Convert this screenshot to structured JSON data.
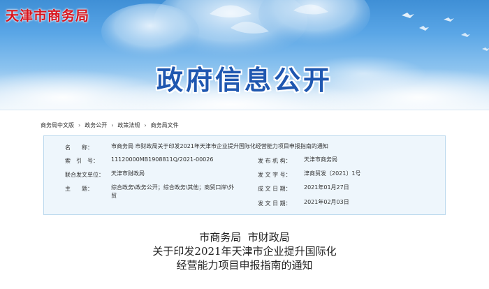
{
  "header": {
    "site_name": "天津市商务局",
    "banner_title": "政府信息公开"
  },
  "breadcrumb": {
    "items": [
      "商务局中文版",
      "政务公开",
      "政策法规",
      "商务局文件"
    ],
    "separator": "›"
  },
  "info": {
    "name_label": "名　　称：",
    "name_value": "市商务局 市财政局关于印发2021年天津市企业提升国际化经营能力项目申报指南的通知",
    "index_label": "索　引　号：",
    "index_value": "11120000MB1908811Q/2021-00026",
    "issuer_label": "发 布 机 构：",
    "issuer_value": "天津市商务局",
    "co_issuer_label": "联合发文单位：",
    "co_issuer_value": "天津市财政局",
    "doc_number_label": "发 文 字 号：",
    "doc_number_value": "津商贸发〔2021〕1号",
    "subject_label": "主　　题：",
    "subject_value": "综合政务\\政务公开；综合政务\\其他；商贸口岸\\外贸",
    "created_label": "成 文 日 期：",
    "created_value": "2021年01月27日",
    "published_label": "发 文 日 期：",
    "published_value": "2021年02月03日"
  },
  "article": {
    "title_line1": "市商务局  市财政局",
    "title_line2": "关于印发2021年天津市企业提升国际化",
    "title_line3": "经营能力项目申报指南的通知"
  },
  "colors": {
    "site_name": "#d9141c",
    "banner_title": "#1f57b0",
    "info_bg": "#eef6fc",
    "info_border": "#bcd9ee"
  }
}
